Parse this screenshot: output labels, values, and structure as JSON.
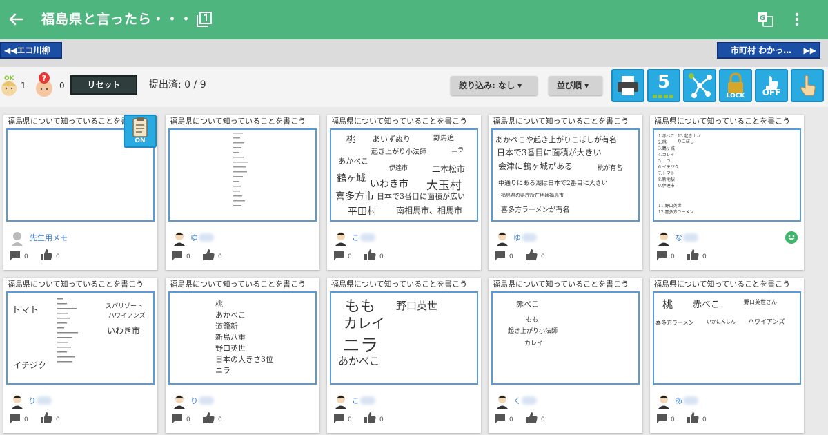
{
  "header": {
    "title": "福島県と言ったら・・・",
    "back_icon": "arrow-left-icon",
    "count_icon": "layers-one-icon",
    "translate_icon": "translate-icon",
    "more_icon": "more-vertical-icon",
    "bar_color": "#4fb57e"
  },
  "navigation": {
    "prev_label": "◀◀エコ川柳",
    "next_label": "市町村 わかっ…",
    "next_arrow": "▶▶"
  },
  "toolbar": {
    "ok_count": "1",
    "question_count": "0",
    "reset_label": "リセット",
    "submitted_text": "提出済: 0 / 9",
    "filter_label": "絞り込み: なし ▾",
    "sort_label": "並び順 ▾",
    "timer_value": "5",
    "lock_label": "LOCK",
    "off_label": "OFF",
    "accent_color": "#29abe2"
  },
  "cards": [
    {
      "heading": "福島県について知っていることを書こう",
      "author": "先生用メモ",
      "comments": "0",
      "likes": "0",
      "badge": "ON",
      "lines": []
    },
    {
      "heading": "福島県について知っていることを書こう",
      "author": "ゆ",
      "comments": "0",
      "likes": "0",
      "lines": []
    },
    {
      "heading": "福島県について知っていることを書こう",
      "author": "こ",
      "comments": "0",
      "likes": "0",
      "lines": [
        "桃",
        "あいずぬり",
        "野馬追",
        "起き上がり小法師",
        "ニラ",
        "あかべこ",
        "伊達市",
        "二本松市",
        "鶴ヶ城",
        "いわき市",
        "大玉村",
        "喜多方市",
        "日本で3番目に面積が広い",
        "平田村",
        "南相馬市、相馬市"
      ]
    },
    {
      "heading": "福島県について知っていることを書こう",
      "author": "ゆ",
      "comments": "0",
      "likes": "0",
      "lines": [
        "あかべこや起き上がりこぼしが有名",
        "日本で3番目に面積が大きい",
        "会津に鶴ヶ城がある",
        "桃が有名",
        "中通りにある湖は日本で2番目に大きい",
        "福島県の県庁所在地は福島市",
        "喜多方ラーメンが有名"
      ]
    },
    {
      "heading": "福島県について知っていることを書こう",
      "author": "な",
      "comments": "0",
      "likes": "0",
      "lines": [
        "1.赤べこ",
        "2.桃",
        "3.鶴ヶ城",
        "4.カレイ",
        "5.ニラ",
        "6.イチジク",
        "7.トマト",
        "8.新地駅",
        "9.伊達市",
        "13.起き上が",
        "りこぼし",
        "11.野口英世",
        "12.喜多方ラーメン"
      ]
    },
    {
      "heading": "福島県について知っていることを書こう",
      "author": "り",
      "comments": "0",
      "likes": "0",
      "lines": [
        "トマト",
        "スパリゾート",
        "ハワイアンズ",
        "いわき市",
        "イチジク"
      ]
    },
    {
      "heading": "福島県について知っていることを書こう",
      "author": "り",
      "comments": "0",
      "likes": "0",
      "lines": [
        "桃",
        "あかべこ",
        "道籠新",
        "新島八重",
        "野口英世",
        "日本の大きさ3位",
        "ニラ"
      ]
    },
    {
      "heading": "福島県について知っていることを書こう",
      "author": "こ",
      "comments": "0",
      "likes": "0",
      "lines": [
        "もも",
        "野口英世",
        "カレイ",
        "ニラ",
        "あかべこ"
      ]
    },
    {
      "heading": "福島県について知っていることを書こう",
      "author": "く",
      "comments": "0",
      "likes": "0",
      "lines": [
        "赤べこ",
        "もも",
        "起き上がり小法師",
        "カレイ"
      ]
    },
    {
      "heading": "福島県について知っていることを書こう",
      "author": "あ",
      "comments": "0",
      "likes": "0",
      "lines": [
        "桃",
        "赤べこ",
        "野口英世さん",
        "喜多方ラーメン",
        "いかにんじん",
        "ハワイアンズ"
      ]
    }
  ]
}
